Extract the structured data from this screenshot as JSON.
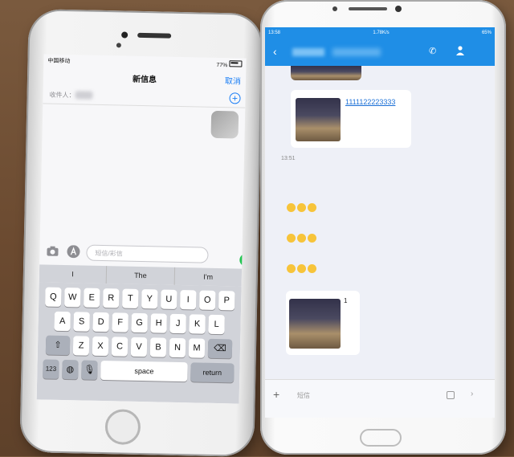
{
  "iphone": {
    "status": {
      "carrier": "中国移动",
      "battery": "77%"
    },
    "nav": {
      "title": "新信息",
      "cancel": "取消"
    },
    "to_label": "收件人：",
    "input_placeholder": "短信/彩信",
    "suggestions": [
      "I",
      "The",
      "I'm"
    ],
    "keyboard": {
      "row1": [
        "Q",
        "W",
        "E",
        "R",
        "T",
        "Y",
        "U",
        "I",
        "O",
        "P"
      ],
      "row2": [
        "A",
        "S",
        "D",
        "F",
        "G",
        "H",
        "J",
        "K",
        "L"
      ],
      "row3": [
        "Z",
        "X",
        "C",
        "V",
        "B",
        "N",
        "M"
      ],
      "numbers_key": "123",
      "space_key": "space",
      "return_key": "return"
    }
  },
  "android": {
    "status": {
      "time": "13:58",
      "speed": "1.78K/s",
      "battery": "65%"
    },
    "messages": {
      "link_text": "1111122223333",
      "timestamp": "13:51",
      "image_caption": "1"
    },
    "input_placeholder": "短信"
  }
}
